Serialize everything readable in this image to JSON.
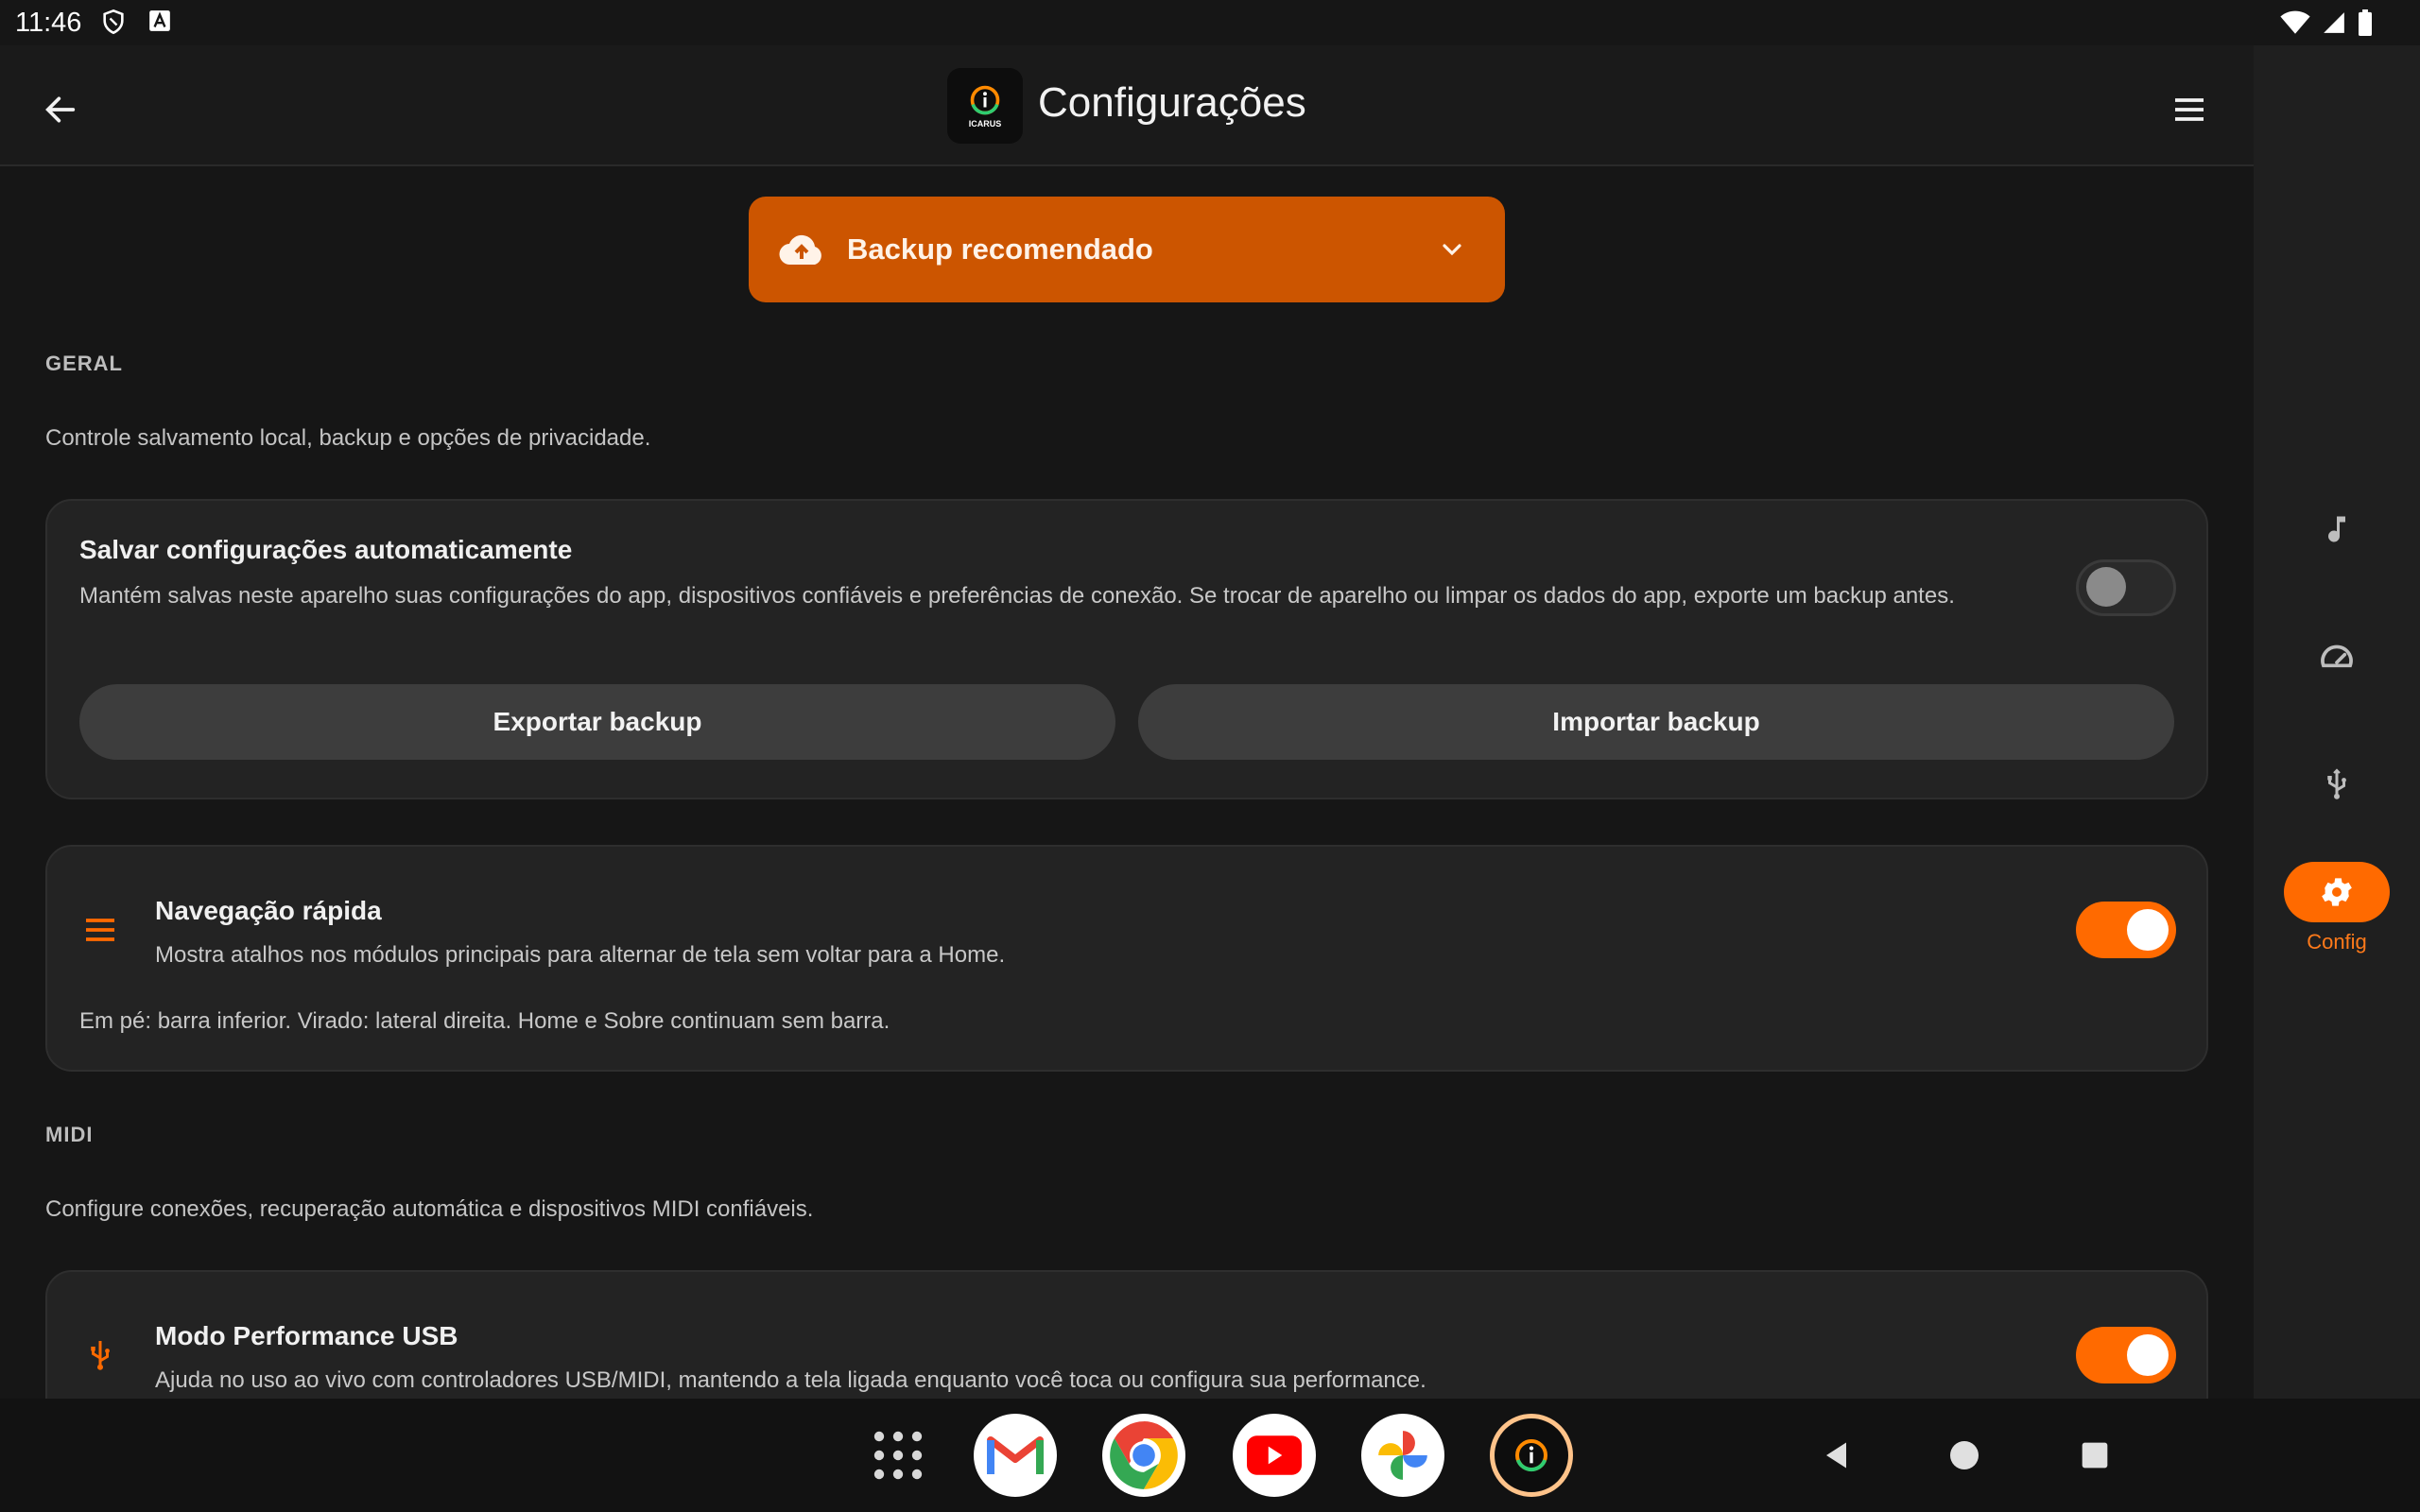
{
  "status_bar": {
    "time": "11:46"
  },
  "app_bar": {
    "title": "Configurações",
    "logo_text": "ICARUS"
  },
  "banner": {
    "title": "Backup recomendado"
  },
  "sections": {
    "general": {
      "label": "GERAL",
      "description": "Controle salvamento local, backup e opções de privacidade."
    },
    "midi": {
      "label": "MIDI",
      "description": "Configure conexões, recuperação automática e dispositivos MIDI confiáveis."
    }
  },
  "autosave_card": {
    "title": "Salvar configurações automaticamente",
    "description": "Mantém salvas neste aparelho suas configurações do app, dispositivos confiáveis e preferências de conexão. Se trocar de aparelho ou limpar os dados do app, exporte um backup antes.",
    "toggle_on": false,
    "export_label": "Exportar backup",
    "import_label": "Importar backup"
  },
  "quicknav_card": {
    "title": "Navegação rápida",
    "description": "Mostra atalhos nos módulos principais para alternar de tela sem voltar para a Home.",
    "note": "Em pé: barra inferior. Virado: lateral direita. Home e Sobre continuam sem barra.",
    "toggle_on": true
  },
  "usb_card": {
    "title": "Modo Performance USB",
    "description": "Ajuda no uso ao vivo com controladores USB/MIDI, mantendo a tela ligada enquanto você toca ou configura sua performance.",
    "toggle_on": true
  },
  "rail": {
    "items": [
      {
        "icon": "music-note-icon"
      },
      {
        "icon": "speedometer-icon"
      },
      {
        "icon": "usb-icon"
      },
      {
        "icon": "gear-icon",
        "label": "Config",
        "active": true
      }
    ]
  },
  "dock": {
    "apps": [
      "app-drawer",
      "gmail",
      "chrome",
      "youtube",
      "photos",
      "icarus"
    ]
  },
  "colors": {
    "accent": "#ff6a00",
    "banner": "#cc5500",
    "background": "#161616",
    "card": "#232323"
  }
}
